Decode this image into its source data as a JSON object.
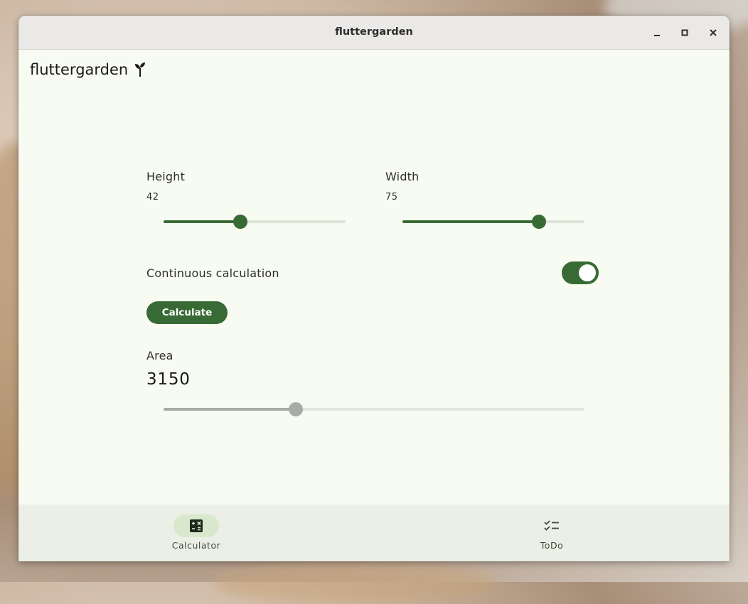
{
  "window": {
    "title": "fluttergarden"
  },
  "appbar": {
    "title": "fluttergarden",
    "icon": "sprout-icon"
  },
  "height": {
    "label": "Height",
    "value": "42",
    "min": 0,
    "max": 100,
    "current": 42
  },
  "width": {
    "label": "Width",
    "value": "75",
    "min": 0,
    "max": 100,
    "current": 75
  },
  "continuous": {
    "label": "Continuous calculation",
    "enabled": true
  },
  "calculate": {
    "label": "Calculate"
  },
  "area": {
    "label": "Area",
    "value": "3150",
    "min": 0,
    "max": 10000,
    "current": 3150
  },
  "nav": {
    "items": [
      {
        "label": "Calculator",
        "icon": "calculator-icon",
        "selected": true
      },
      {
        "label": "ToDo",
        "icon": "checklist-icon",
        "selected": false
      }
    ]
  },
  "colors": {
    "primary": "#386a35",
    "surface": "#f8fbf1",
    "nav_bg": "#ecefe5",
    "indicator": "#d7e8cd"
  }
}
